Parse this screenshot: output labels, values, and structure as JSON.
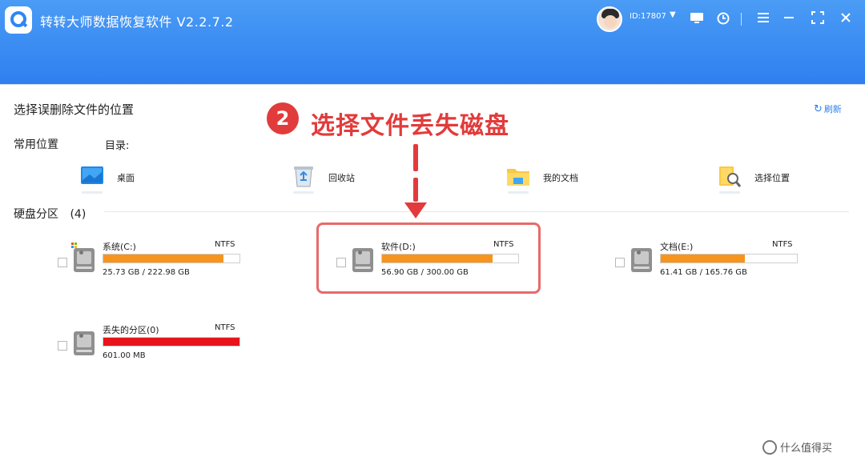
{
  "app": {
    "title": "转转大师数据恢复软件 V2.2.7.2",
    "user_id": "ID:17807",
    "accent": "#2f7ff0"
  },
  "header_icons": [
    "caret-down-icon",
    "screen-icon",
    "timer-icon",
    "menu-icon",
    "minimize-icon",
    "maximize-icon",
    "close-icon"
  ],
  "page": {
    "title": "选择误删除文件的位置",
    "refresh_label": "刷新"
  },
  "common": {
    "label": "常用位置",
    "dir_label": "目录:",
    "locations": [
      {
        "label": "桌面",
        "icon": "desktop-icon"
      },
      {
        "label": "回收站",
        "icon": "recycle-bin-icon"
      },
      {
        "label": "我的文档",
        "icon": "folder-icon"
      },
      {
        "label": "选择位置",
        "icon": "search-folder-icon"
      }
    ]
  },
  "disks": {
    "label": "硬盘分区",
    "count": "(4)",
    "partitions": [
      {
        "name": "系统(C:)",
        "fs": "NTFS",
        "size": "25.73 GB / 222.98 GB",
        "usage": 0.88,
        "color": "#f7941d"
      },
      {
        "name": "软件(D:)",
        "fs": "NTFS",
        "size": "56.90 GB / 300.00 GB",
        "usage": 0.81,
        "color": "#f7941d"
      },
      {
        "name": "文档(E:)",
        "fs": "NTFS",
        "size": "61.41 GB / 165.76 GB",
        "usage": 0.62,
        "color": "#f7941d"
      },
      {
        "name": "丢失的分区(0)",
        "fs": "NTFS",
        "size": "601.00 MB",
        "usage": 1.0,
        "color": "#e8141b"
      }
    ]
  },
  "annotation": {
    "step": "2",
    "text": "选择文件丢失磁盘",
    "color": "#e23b3b"
  },
  "watermark": "什么值得买"
}
